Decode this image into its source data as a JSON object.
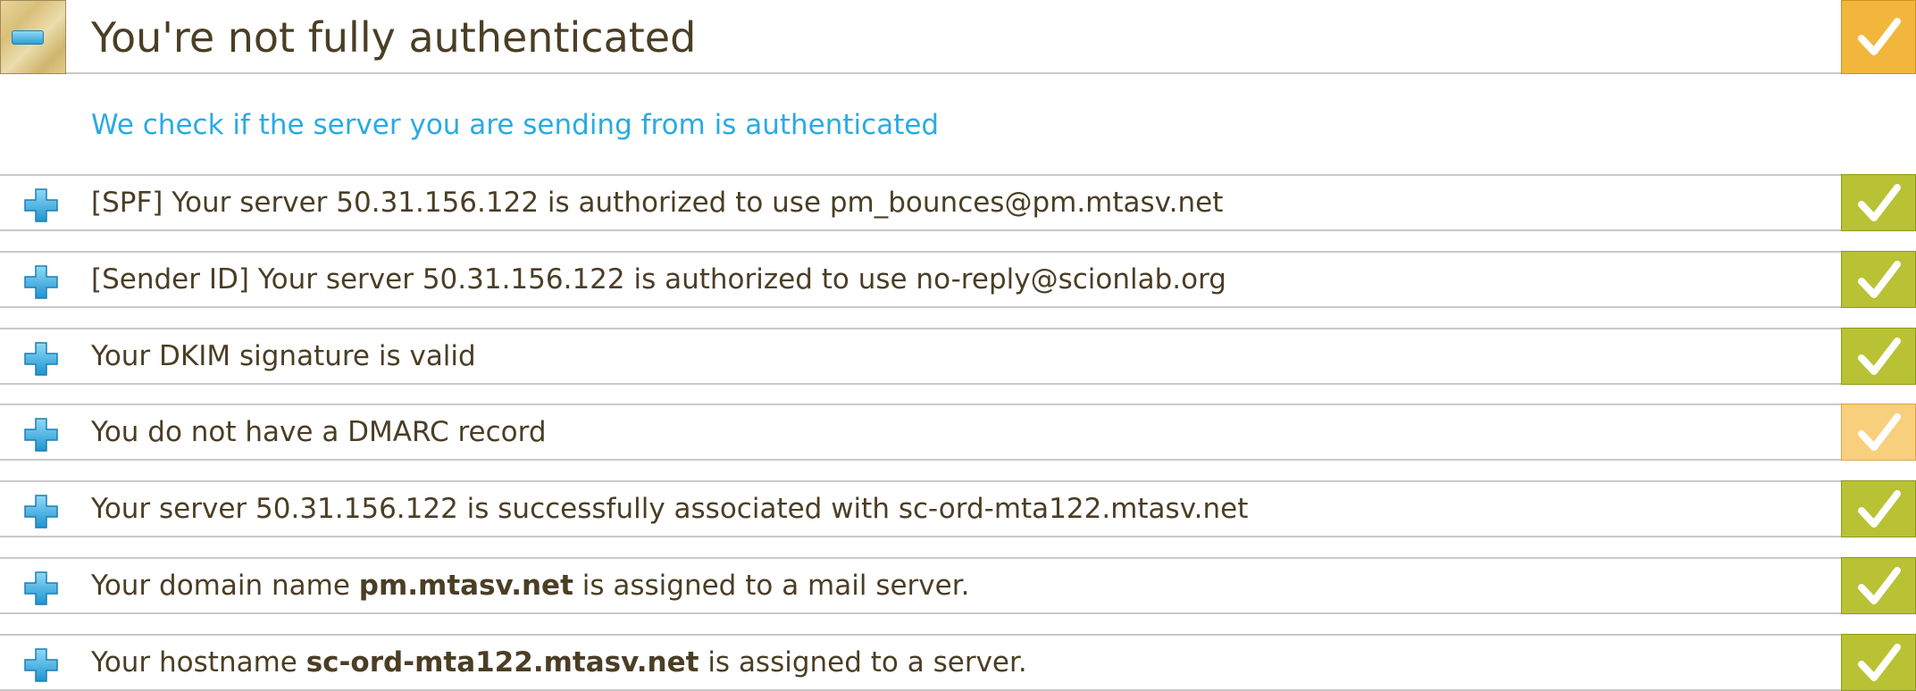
{
  "header": {
    "title": "You're not fully authenticated",
    "collapse_icon": "minus-icon",
    "status_icon": "checkmark-icon",
    "status_color": "#f3b63d"
  },
  "subtitle": "We check if the server you are sending from is authenticated",
  "rows": [
    {
      "text": "[SPF] Your server 50.31.156.122 is authorized to use pm_bounces@pm.mtasv.net",
      "status": "pass"
    },
    {
      "text": "[Sender ID] Your server 50.31.156.122 is authorized to use no-reply@scionlab.org",
      "status": "pass"
    },
    {
      "text": "Your DKIM signature is valid",
      "status": "pass"
    },
    {
      "text": "You do not have a DMARC record",
      "status": "warning"
    },
    {
      "text": "Your server 50.31.156.122 is successfully associated with sc-ord-mta122.mtasv.net",
      "status": "pass"
    },
    {
      "prefix": "Your domain name ",
      "bold": "pm.mtasv.net",
      "suffix": " is assigned to a mail server.",
      "status": "pass"
    },
    {
      "prefix": "Your hostname ",
      "bold": "sc-ord-mta122.mtasv.net",
      "suffix": " is assigned to a server.",
      "status": "pass"
    }
  ],
  "colors": {
    "pass": "#b8c234",
    "warning": "#f8cf7c",
    "link": "#29abe2",
    "text": "#4b3e25"
  },
  "row_icon": "plus-icon"
}
